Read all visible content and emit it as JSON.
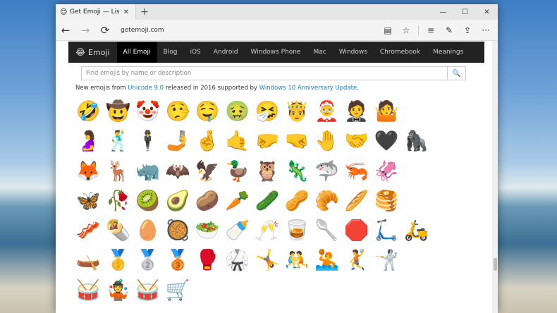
{
  "browser": {
    "tab_title": "Get Emoji — List of",
    "tab_favicon": "😊",
    "tab_close": "✕",
    "new_tab": "+",
    "window_controls": {
      "minimize": "—",
      "maximize": "☐",
      "close": "✕"
    },
    "nav": {
      "back": "←",
      "forward": "→",
      "refresh": "⟳"
    },
    "url": "getemoji.com",
    "tools": {
      "reading_view": "▤",
      "favorite": "☆",
      "hub": "≡",
      "notes": "✎",
      "share": "⇪",
      "more": "···"
    }
  },
  "site": {
    "brand_emoji": "😂",
    "brand": "Emoji",
    "nav": [
      "All Emoji",
      "Blog",
      "iOS",
      "Android",
      "Windows Phone",
      "Mac",
      "Windows",
      "Chromebook",
      "Meanings"
    ],
    "active_index": 0,
    "search_placeholder": "Find emojis by name or description",
    "search_icon": "🔍",
    "notice": {
      "prefix": "New emojis from ",
      "link1": "Unicode 9.0",
      "middle": " released in 2016 supported by ",
      "link2": "Windows 10 Anniversary Update",
      "suffix": "."
    }
  },
  "emojis": [
    "🤣",
    "🤠",
    "🤡",
    "🤥",
    "🤤",
    "🤢",
    "🤧",
    "🤴",
    "🤶",
    "🤵",
    "🤷",
    "🤰",
    "🕺",
    "🕴",
    "🤳",
    "🤞",
    "🤙",
    "🤛",
    "🤜",
    "🤚",
    "🤝",
    "🖤",
    "🦍",
    "🦊",
    "🦌",
    "🦏",
    "🦇",
    "🦅",
    "🦆",
    "🦉",
    "🦎",
    "🦈",
    "🦐",
    "🦑",
    "🦋",
    "🥀",
    "🥝",
    "🥑",
    "🥔",
    "🥕",
    "🥒",
    "🥜",
    "🥐",
    "🥖",
    "🥞",
    "🥓",
    "🌯",
    "🥚",
    "🥘",
    "🥗",
    "🍼",
    "🥂",
    "🥃",
    "🥄",
    "🛑",
    "🛴",
    "🛵",
    "🛶",
    "🥇",
    "🥈",
    "🥉",
    "🥊",
    "🥋",
    "🤸",
    "🤼",
    "🤽",
    "🤾",
    "🤺",
    "🥁",
    "🤹",
    "🥁",
    "🛒"
  ]
}
